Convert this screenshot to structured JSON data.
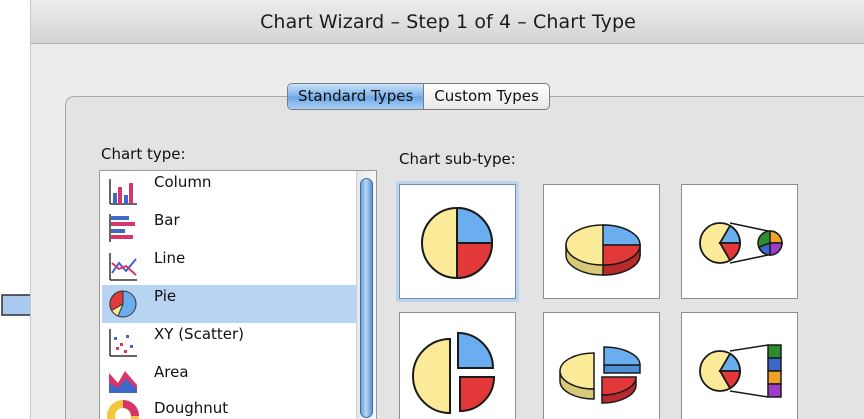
{
  "window": {
    "title": "Chart Wizard – Step 1 of 4 – Chart Type"
  },
  "tabs": [
    {
      "label": "Standard Types",
      "active": true
    },
    {
      "label": "Custom Types",
      "active": false
    }
  ],
  "chart_type_label": "Chart type:",
  "chart_subtype_label": "Chart sub-type:",
  "chart_types": [
    {
      "label": "Column",
      "icon": "column-chart-icon",
      "selected": false
    },
    {
      "label": "Bar",
      "icon": "bar-chart-icon",
      "selected": false
    },
    {
      "label": "Line",
      "icon": "line-chart-icon",
      "selected": false
    },
    {
      "label": "Pie",
      "icon": "pie-chart-icon",
      "selected": true
    },
    {
      "label": "XY (Scatter)",
      "icon": "scatter-chart-icon",
      "selected": false
    },
    {
      "label": "Area",
      "icon": "area-chart-icon",
      "selected": false
    },
    {
      "label": "Doughnut",
      "icon": "doughnut-chart-icon",
      "selected": false
    }
  ],
  "chart_subtypes": [
    {
      "name": "pie",
      "icon": "pie-icon",
      "selected": true
    },
    {
      "name": "3d-pie",
      "icon": "3d-pie-icon",
      "selected": false
    },
    {
      "name": "pie-of-pie",
      "icon": "pie-of-pie-icon",
      "selected": false
    },
    {
      "name": "exploded-pie",
      "icon": "exploded-pie-icon",
      "selected": false
    },
    {
      "name": "exploded-3d-pie",
      "icon": "exploded-3d-pie-icon",
      "selected": false
    },
    {
      "name": "bar-of-pie",
      "icon": "bar-of-pie-icon",
      "selected": false
    }
  ],
  "colors": {
    "pie_yellow": "#fbeb98",
    "pie_blue": "#6aaef0",
    "pie_red": "#e2383a",
    "selection": "#b9d3f3",
    "annotation_arrow": "#a9c9ef"
  }
}
